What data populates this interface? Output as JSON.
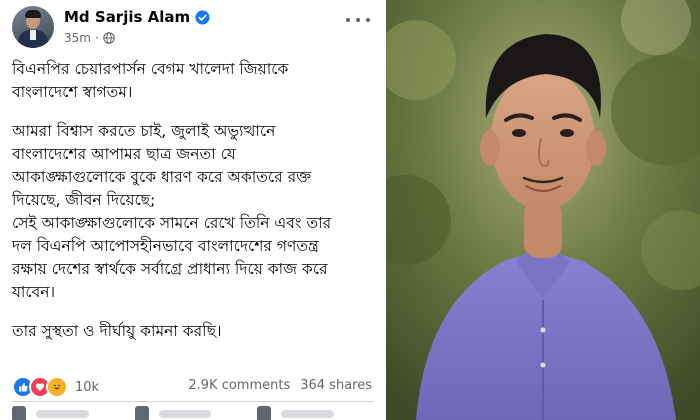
{
  "post": {
    "author": "Md Sarjis Alam",
    "time": "35m",
    "separator": "·",
    "paragraphs": [
      "বিএনপির চেয়ারপার্সন বেগম খালেদা জিয়াকে\nবাংলাদেশে স্বাগতম।",
      "আমরা বিশ্বাস করতে চাই, জুলাই অভ্যুত্থানে\nবাংলাদেশের আপামর ছাত্র জনতা যে\nআকাঙ্ক্ষাগুলোকে বুকে ধারণ করে অকাতরে রক্ত\nদিয়েছে, জীবন দিয়েছে;\nসেই আকাঙ্ক্ষাগুলোকে সামনে রেখে তিনি এবং তার\nদল বিএনপি আপোসহীনভাবে বাংলাদেশের গণতন্ত্র\nরক্ষায় দেশের স্বার্থকে সর্বাগ্রে প্রাধান্য দিয়ে কাজ করে\nযাবেন।",
      "তার সুস্থতা ও দীর্ঘায়ু কামনা করছি।"
    ],
    "reactions_count": "10k",
    "comments": "2.9K comments",
    "shares": "364 shares"
  },
  "icons": {
    "verified": "verified-badge-icon",
    "audience": "globe-icon",
    "more": "more-options-icon",
    "reactions": [
      "like-icon",
      "love-icon",
      "haha-icon"
    ]
  },
  "colors": {
    "verified": "#1877f2",
    "meta_text": "#65676b",
    "body_text": "#050505",
    "shirt": "#7d73c7"
  }
}
